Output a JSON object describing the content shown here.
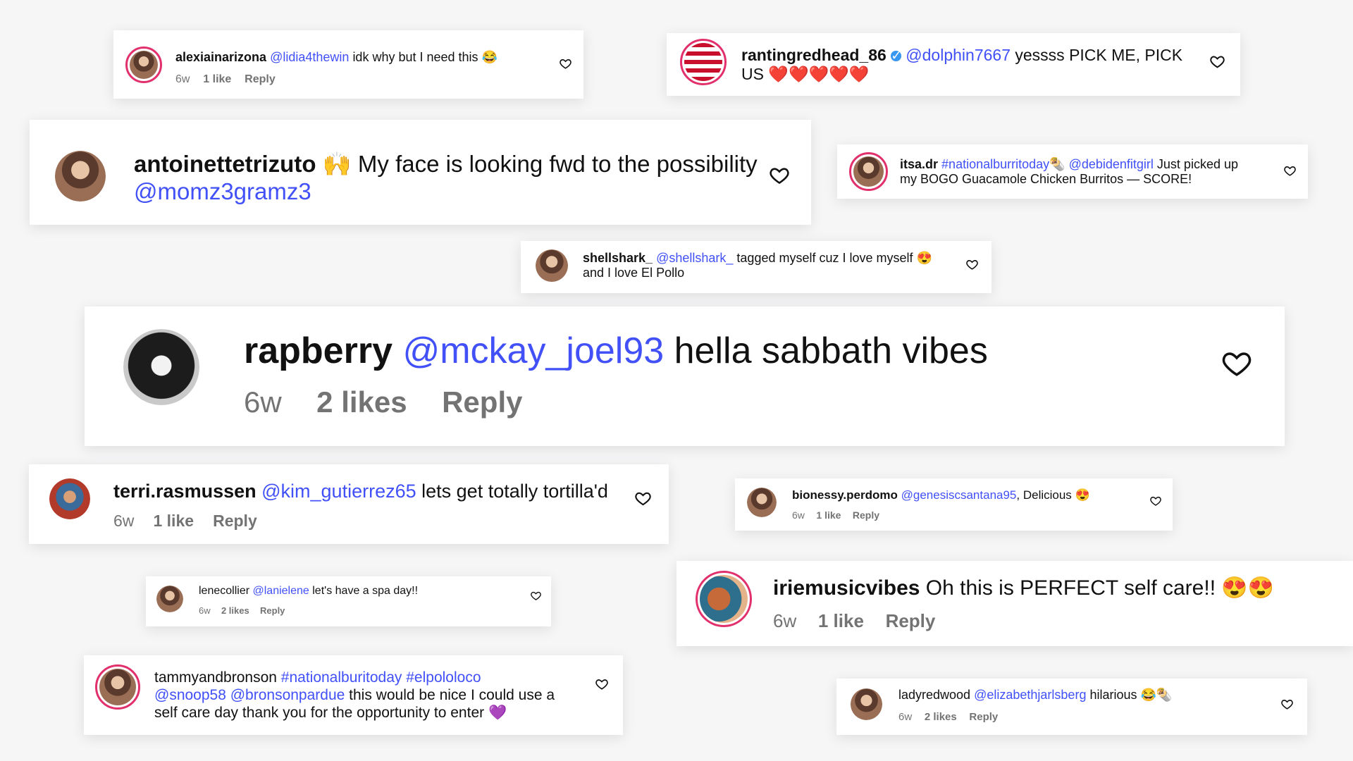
{
  "comments": [
    {
      "user": "alexiainarizona",
      "mention": "@lidia4thewin",
      "text": "idk why but I need this 😂",
      "time": "6w",
      "likes": "1 like",
      "reply": "Reply"
    },
    {
      "user": "rantingredhead_86",
      "mention": "@dolphin7667",
      "text": "yessss PICK ME, PICK",
      "text2": "US ❤️❤️❤️❤️❤️"
    },
    {
      "user": "antoinettetrizuto",
      "text": "🙌 My face is looking fwd to the possibility",
      "mention": "@momz3gramz3"
    },
    {
      "user": "itsa.dr",
      "mention": "#nationalburritoday🌯 @debidenfitgirl",
      "text": "Just picked up",
      "text2": "my BOGO Guacamole Chicken Burritos — SCORE!"
    },
    {
      "user": "shellshark_",
      "mention": "@shellshark_",
      "text": "tagged myself cuz I love myself 😍",
      "text2": "and I love El Pollo"
    },
    {
      "user": "rapberry",
      "mention": "@mckay_joel93",
      "text": "hella sabbath vibes",
      "time": "6w",
      "likes": "2 likes",
      "reply": "Reply"
    },
    {
      "user": "terri.rasmussen",
      "mention": "@kim_gutierrez65",
      "text": "lets get totally tortilla'd",
      "time": "6w",
      "likes": "1 like",
      "reply": "Reply"
    },
    {
      "user": "bionessy.perdomo",
      "mention": "@genesiscsantana95",
      "text": ", Delicious 😍",
      "time": "6w",
      "likes": "1 like",
      "reply": "Reply"
    },
    {
      "user": "lenecollier",
      "mention": "@lanielene",
      "text": "let's have a spa day!!",
      "time": "6w",
      "likes": "2 likes",
      "reply": "Reply"
    },
    {
      "user": "iriemusicvibes",
      "text": "Oh this is PERFECT self care!! 😍😍",
      "time": "6w",
      "likes": "1 like",
      "reply": "Reply"
    },
    {
      "user": "tammyandbronson",
      "mention": "#nationalburitoday #elpololoco",
      "mention2": "@snoop58 @bronsonpardue",
      "text": "this would be nice I could use a",
      "text2": "self care day thank you for the opportunity to enter 💜"
    },
    {
      "user": "ladyredwood",
      "mention": "@elizabethjarlsberg",
      "text": "hilarious 😂🌯",
      "time": "6w",
      "likes": "2 likes",
      "reply": "Reply"
    }
  ],
  "icons": {
    "heart": "heart-outline-icon",
    "verified": "verified-badge-icon"
  },
  "colors": {
    "mention": "#4150f7",
    "meta": "#737373",
    "ring": "#e1306c"
  }
}
